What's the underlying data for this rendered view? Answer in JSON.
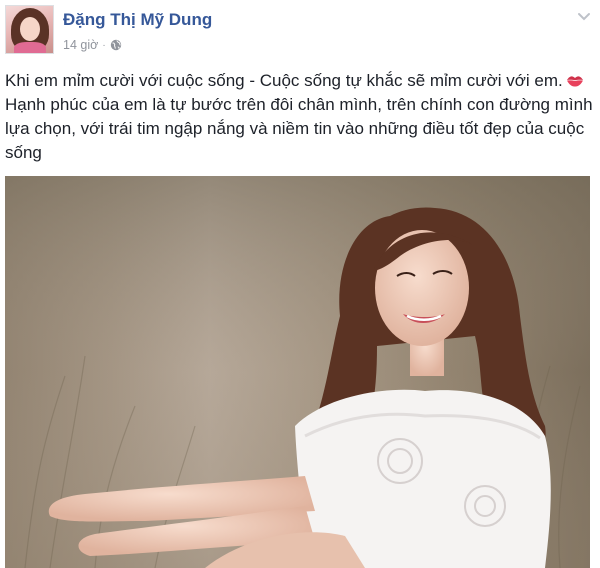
{
  "post": {
    "author_name": "Đặng Thị Mỹ Dung",
    "timestamp": "14 giờ",
    "separator": "·",
    "privacy_icon": "globe-icon",
    "options_icon": "chevron-down-icon",
    "text_line1": "Khi em mỉm cười với cuộc sống - Cuộc sống tự khắc sẽ mỉm cười với em.",
    "text_rest": "Hạnh phúc của em là tự bước trên đôi chân mình, trên chính con đường mình lựa chọn, với trái tim ngập nắng và niềm tin vào những điều tốt đẹp của cuộc sống",
    "emoji_icon": "kiss-mark-icon"
  },
  "colors": {
    "name_link": "#365899",
    "meta_text": "#90949c",
    "body_text": "#1d2129"
  }
}
